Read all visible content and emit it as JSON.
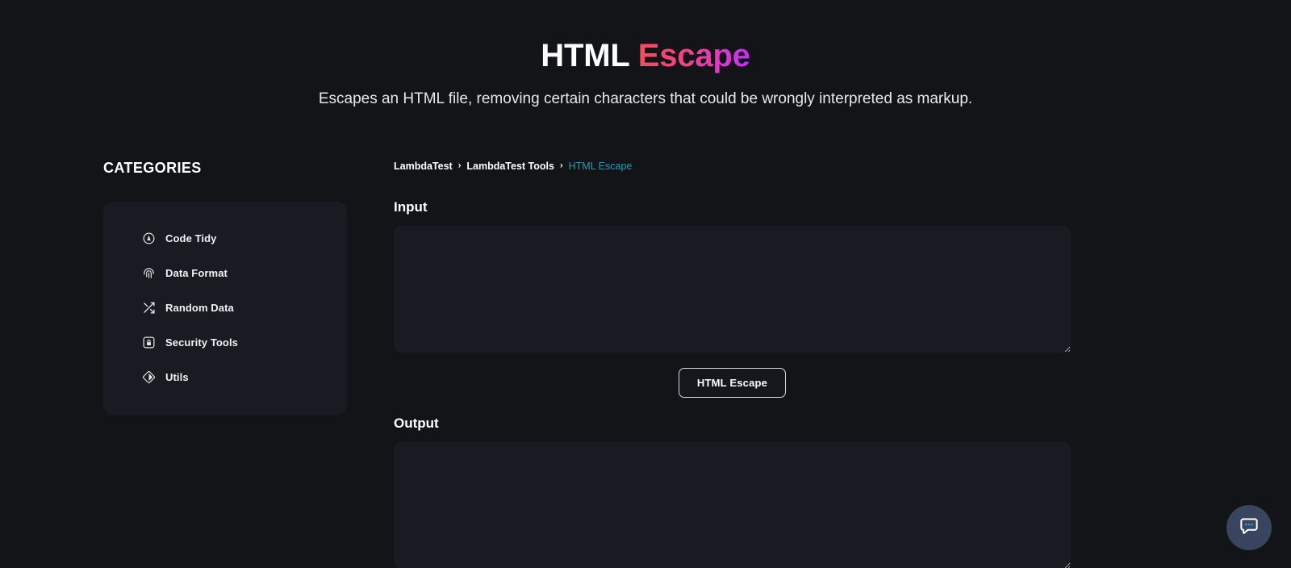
{
  "hero": {
    "title_plain": "HTML",
    "title_accent": "Escape",
    "subtitle": "Escapes an HTML file, removing certain characters that could be wrongly interpreted as markup."
  },
  "sidebar": {
    "heading": "CATEGORIES",
    "items": [
      {
        "label": "Code Tidy",
        "icon": "code-tidy-icon"
      },
      {
        "label": "Data Format",
        "icon": "fingerprint-icon"
      },
      {
        "label": "Random Data",
        "icon": "shuffle-icon"
      },
      {
        "label": "Security Tools",
        "icon": "lock-icon"
      },
      {
        "label": "Utils",
        "icon": "gem-icon"
      }
    ]
  },
  "breadcrumb": {
    "separator": "›",
    "items": [
      {
        "label": "LambdaTest",
        "current": false
      },
      {
        "label": "LambdaTest Tools",
        "current": false
      },
      {
        "label": "HTML Escape",
        "current": true
      }
    ]
  },
  "main": {
    "input_label": "Input",
    "input_value": "",
    "input_placeholder": "",
    "action_label": "HTML Escape",
    "output_label": "Output",
    "output_value": "",
    "output_placeholder": ""
  },
  "chat": {
    "icon": "chat-bubble-icon",
    "aria_label": "Open chat"
  },
  "colors": {
    "page_background": "#131417",
    "surface": "#191b23",
    "accent_gradient_start": "#f84b5e",
    "accent_gradient_end": "#c22ef2",
    "breadcrumb_current": "#2a9bb5",
    "chat_background": "#39455f",
    "chat_icon_dots": "#2a9bb5"
  }
}
